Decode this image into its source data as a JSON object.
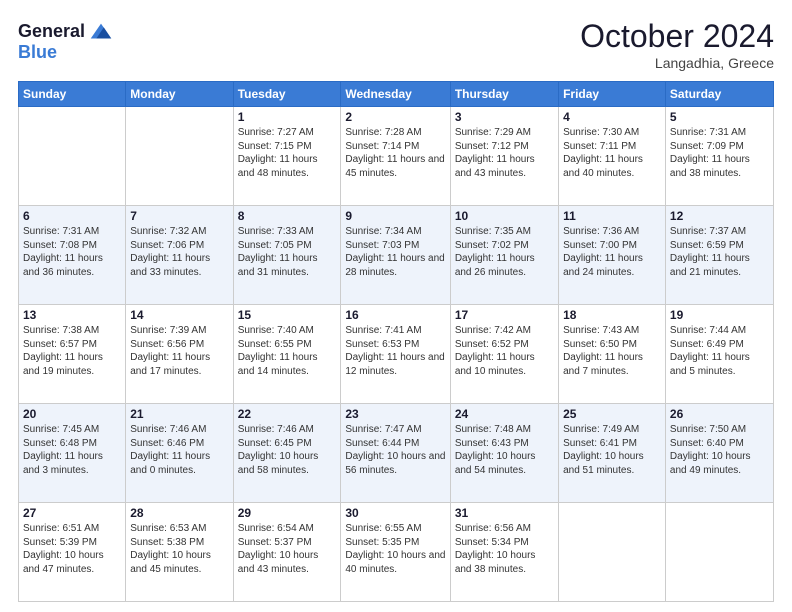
{
  "header": {
    "logo_line1": "General",
    "logo_line2": "Blue",
    "month": "October 2024",
    "location": "Langadhia, Greece"
  },
  "weekdays": [
    "Sunday",
    "Monday",
    "Tuesday",
    "Wednesday",
    "Thursday",
    "Friday",
    "Saturday"
  ],
  "weeks": [
    [
      {
        "day": "",
        "info": ""
      },
      {
        "day": "",
        "info": ""
      },
      {
        "day": "1",
        "info": "Sunrise: 7:27 AM\nSunset: 7:15 PM\nDaylight: 11 hours and 48 minutes."
      },
      {
        "day": "2",
        "info": "Sunrise: 7:28 AM\nSunset: 7:14 PM\nDaylight: 11 hours and 45 minutes."
      },
      {
        "day": "3",
        "info": "Sunrise: 7:29 AM\nSunset: 7:12 PM\nDaylight: 11 hours and 43 minutes."
      },
      {
        "day": "4",
        "info": "Sunrise: 7:30 AM\nSunset: 7:11 PM\nDaylight: 11 hours and 40 minutes."
      },
      {
        "day": "5",
        "info": "Sunrise: 7:31 AM\nSunset: 7:09 PM\nDaylight: 11 hours and 38 minutes."
      }
    ],
    [
      {
        "day": "6",
        "info": "Sunrise: 7:31 AM\nSunset: 7:08 PM\nDaylight: 11 hours and 36 minutes."
      },
      {
        "day": "7",
        "info": "Sunrise: 7:32 AM\nSunset: 7:06 PM\nDaylight: 11 hours and 33 minutes."
      },
      {
        "day": "8",
        "info": "Sunrise: 7:33 AM\nSunset: 7:05 PM\nDaylight: 11 hours and 31 minutes."
      },
      {
        "day": "9",
        "info": "Sunrise: 7:34 AM\nSunset: 7:03 PM\nDaylight: 11 hours and 28 minutes."
      },
      {
        "day": "10",
        "info": "Sunrise: 7:35 AM\nSunset: 7:02 PM\nDaylight: 11 hours and 26 minutes."
      },
      {
        "day": "11",
        "info": "Sunrise: 7:36 AM\nSunset: 7:00 PM\nDaylight: 11 hours and 24 minutes."
      },
      {
        "day": "12",
        "info": "Sunrise: 7:37 AM\nSunset: 6:59 PM\nDaylight: 11 hours and 21 minutes."
      }
    ],
    [
      {
        "day": "13",
        "info": "Sunrise: 7:38 AM\nSunset: 6:57 PM\nDaylight: 11 hours and 19 minutes."
      },
      {
        "day": "14",
        "info": "Sunrise: 7:39 AM\nSunset: 6:56 PM\nDaylight: 11 hours and 17 minutes."
      },
      {
        "day": "15",
        "info": "Sunrise: 7:40 AM\nSunset: 6:55 PM\nDaylight: 11 hours and 14 minutes."
      },
      {
        "day": "16",
        "info": "Sunrise: 7:41 AM\nSunset: 6:53 PM\nDaylight: 11 hours and 12 minutes."
      },
      {
        "day": "17",
        "info": "Sunrise: 7:42 AM\nSunset: 6:52 PM\nDaylight: 11 hours and 10 minutes."
      },
      {
        "day": "18",
        "info": "Sunrise: 7:43 AM\nSunset: 6:50 PM\nDaylight: 11 hours and 7 minutes."
      },
      {
        "day": "19",
        "info": "Sunrise: 7:44 AM\nSunset: 6:49 PM\nDaylight: 11 hours and 5 minutes."
      }
    ],
    [
      {
        "day": "20",
        "info": "Sunrise: 7:45 AM\nSunset: 6:48 PM\nDaylight: 11 hours and 3 minutes."
      },
      {
        "day": "21",
        "info": "Sunrise: 7:46 AM\nSunset: 6:46 PM\nDaylight: 11 hours and 0 minutes."
      },
      {
        "day": "22",
        "info": "Sunrise: 7:46 AM\nSunset: 6:45 PM\nDaylight: 10 hours and 58 minutes."
      },
      {
        "day": "23",
        "info": "Sunrise: 7:47 AM\nSunset: 6:44 PM\nDaylight: 10 hours and 56 minutes."
      },
      {
        "day": "24",
        "info": "Sunrise: 7:48 AM\nSunset: 6:43 PM\nDaylight: 10 hours and 54 minutes."
      },
      {
        "day": "25",
        "info": "Sunrise: 7:49 AM\nSunset: 6:41 PM\nDaylight: 10 hours and 51 minutes."
      },
      {
        "day": "26",
        "info": "Sunrise: 7:50 AM\nSunset: 6:40 PM\nDaylight: 10 hours and 49 minutes."
      }
    ],
    [
      {
        "day": "27",
        "info": "Sunrise: 6:51 AM\nSunset: 5:39 PM\nDaylight: 10 hours and 47 minutes."
      },
      {
        "day": "28",
        "info": "Sunrise: 6:53 AM\nSunset: 5:38 PM\nDaylight: 10 hours and 45 minutes."
      },
      {
        "day": "29",
        "info": "Sunrise: 6:54 AM\nSunset: 5:37 PM\nDaylight: 10 hours and 43 minutes."
      },
      {
        "day": "30",
        "info": "Sunrise: 6:55 AM\nSunset: 5:35 PM\nDaylight: 10 hours and 40 minutes."
      },
      {
        "day": "31",
        "info": "Sunrise: 6:56 AM\nSunset: 5:34 PM\nDaylight: 10 hours and 38 minutes."
      },
      {
        "day": "",
        "info": ""
      },
      {
        "day": "",
        "info": ""
      }
    ]
  ]
}
